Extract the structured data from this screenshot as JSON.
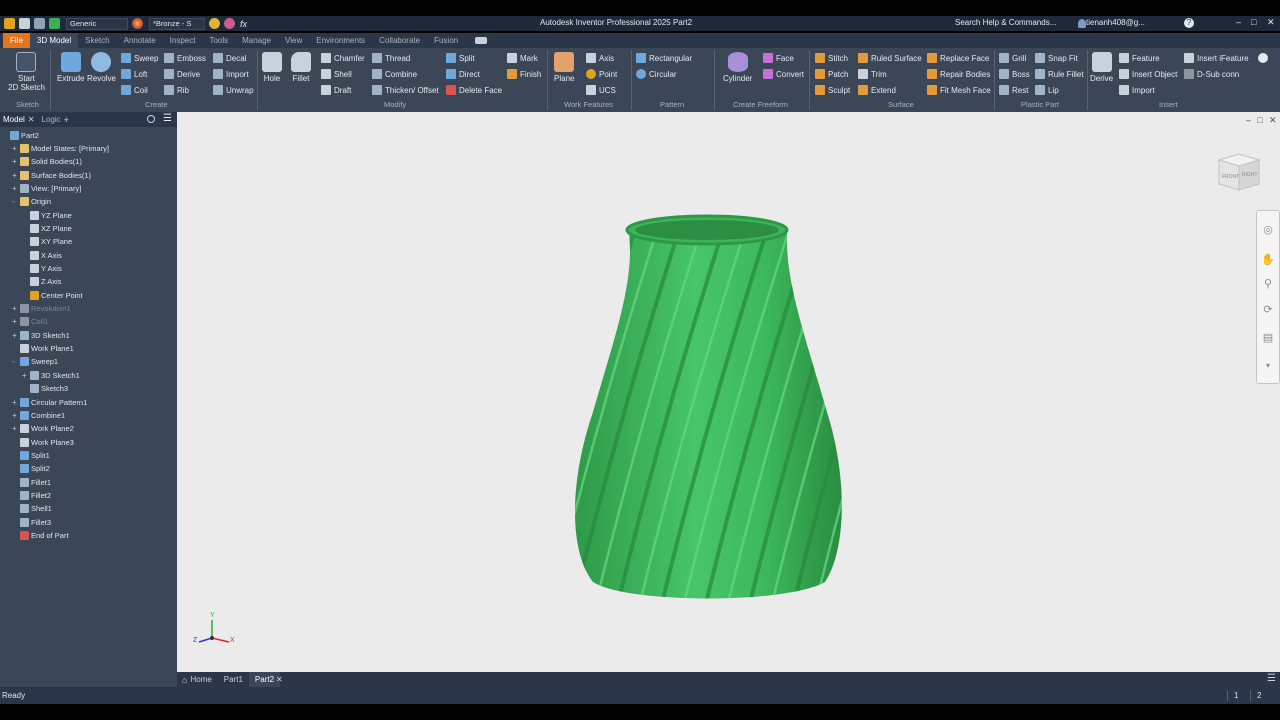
{
  "title_bar": {
    "app_title": "Autodesk Inventor Professional 2025   Part2",
    "appearance": "Generic",
    "material": "*Bronze - S",
    "fx_label": "fx",
    "search_help": "Search Help & Commands...",
    "user_name": "tienanh408@g..."
  },
  "ribbon_tabs": [
    {
      "label": "File"
    },
    {
      "label": "3D Model"
    },
    {
      "label": "Sketch"
    },
    {
      "label": "Annotate"
    },
    {
      "label": "Inspect"
    },
    {
      "label": "Tools"
    },
    {
      "label": "Manage"
    },
    {
      "label": "View"
    },
    {
      "label": "Environments"
    },
    {
      "label": "Collaborate"
    },
    {
      "label": "Fusion"
    }
  ],
  "ribbon": {
    "sketch": {
      "start_line1": "Start",
      "start_line2": "2D Sketch",
      "panel": "Sketch"
    },
    "create": {
      "extrude": "Extrude",
      "revolve": "Revolve",
      "sweep": "Sweep",
      "loft": "Loft",
      "coil": "Coil",
      "emboss": "Emboss",
      "derive": "Derive",
      "rib": "Rib",
      "decal": "Decal",
      "import": "Import",
      "unwrap": "Unwrap",
      "panel": "Create"
    },
    "modify": {
      "hole": "Hole",
      "fillet": "Fillet",
      "chamfer": "Chamfer",
      "shell": "Shell",
      "draft": "Draft",
      "thread": "Thread",
      "combine": "Combine",
      "thicken": "Thicken/ Offset",
      "split": "Split",
      "direct": "Direct",
      "delete_face": "Delete Face",
      "mark": "Mark",
      "finish": "Finish",
      "panel": "Modify"
    },
    "work_features": {
      "plane": "Plane",
      "axis": "Axis",
      "point": "Point",
      "ucs": "UCS",
      "panel": "Work Features"
    },
    "pattern": {
      "rectangular": "Rectangular",
      "circular": "Circular",
      "panel": "Pattern"
    },
    "freeform": {
      "cylinder": "Cylinder",
      "face": "Face",
      "convert": "Convert",
      "panel": "Create Freeform"
    },
    "surface": {
      "stitch": "Stitch",
      "patch": "Patch",
      "sculpt": "Sculpt",
      "ruled_surface": "Ruled Surface",
      "trim": "Trim",
      "extend": "Extend",
      "replace_face": "Replace Face",
      "repair_bodies": "Repair Bodies",
      "fit_mesh_face": "Fit Mesh Face",
      "panel": "Surface"
    },
    "plastic": {
      "grill": "Grill",
      "boss": "Boss",
      "rest": "Rest",
      "snap_fit": "Snap Fit",
      "rule_fillet": "Rule Fillet",
      "lip": "Lip",
      "panel": "Plastic Part"
    },
    "insert": {
      "derive": "Derive",
      "feature": "Feature",
      "insert_object": "Insert Object",
      "import": "Import",
      "insert_ifeature": "Insert iFeature",
      "dsub": "D-Sub conn",
      "panel": "Insert"
    }
  },
  "browser": {
    "tabs": [
      "Model",
      "Logic"
    ],
    "items": [
      {
        "label": "Part2",
        "exp": "",
        "dim": false
      },
      {
        "label": "Model States: [Primary]",
        "exp": "+",
        "dim": false
      },
      {
        "label": "Solid Bodies(1)",
        "exp": "+",
        "dim": false
      },
      {
        "label": "Surface Bodies(1)",
        "exp": "+",
        "dim": false
      },
      {
        "label": "View: [Primary]",
        "exp": "+",
        "dim": false
      },
      {
        "label": "Origin",
        "exp": "-",
        "dim": false
      },
      {
        "label": "YZ Plane",
        "exp": "",
        "dim": false
      },
      {
        "label": "XZ Plane",
        "exp": "",
        "dim": false
      },
      {
        "label": "XY Plane",
        "exp": "",
        "dim": false
      },
      {
        "label": "X Axis",
        "exp": "",
        "dim": false
      },
      {
        "label": "Y Axis",
        "exp": "",
        "dim": false
      },
      {
        "label": "Z Axis",
        "exp": "",
        "dim": false
      },
      {
        "label": "Center Point",
        "exp": "",
        "dim": false
      },
      {
        "label": "Revolution1",
        "exp": "+",
        "dim": true
      },
      {
        "label": "Coil1",
        "exp": "+",
        "dim": true
      },
      {
        "label": "3D Sketch1",
        "exp": "+",
        "dim": false
      },
      {
        "label": "Work Plane1",
        "exp": "",
        "dim": false
      },
      {
        "label": "Sweep1",
        "exp": "-",
        "dim": false
      },
      {
        "label": "3D Sketch1",
        "exp": "+",
        "dim": false
      },
      {
        "label": "Sketch3",
        "exp": "",
        "dim": false
      },
      {
        "label": "Circular Pattern1",
        "exp": "+",
        "dim": false
      },
      {
        "label": "Combine1",
        "exp": "+",
        "dim": false
      },
      {
        "label": "Work Plane2",
        "exp": "+",
        "dim": false
      },
      {
        "label": "Work Plane3",
        "exp": "",
        "dim": false
      },
      {
        "label": "Split1",
        "exp": "",
        "dim": false
      },
      {
        "label": "Split2",
        "exp": "",
        "dim": false
      },
      {
        "label": "Fillet1",
        "exp": "",
        "dim": false
      },
      {
        "label": "Fillet2",
        "exp": "",
        "dim": false
      },
      {
        "label": "Shell1",
        "exp": "",
        "dim": false
      },
      {
        "label": "Fillet3",
        "exp": "",
        "dim": false
      },
      {
        "label": "End of Part",
        "exp": "",
        "dim": false
      }
    ]
  },
  "viewcube": {
    "front": "FRONT",
    "right": "RIGHT"
  },
  "triad": {
    "x": "X",
    "y": "Y",
    "z": "Z"
  },
  "doc_tabs": [
    {
      "label": "Home"
    },
    {
      "label": "Part1"
    },
    {
      "label": "Part2"
    }
  ],
  "status": {
    "text": "Ready",
    "page1": "1",
    "page2": "2"
  },
  "colors": {
    "accent": "#e3741b",
    "model_green": "#3dba5c",
    "viewport_bg": "#ebebeb"
  }
}
